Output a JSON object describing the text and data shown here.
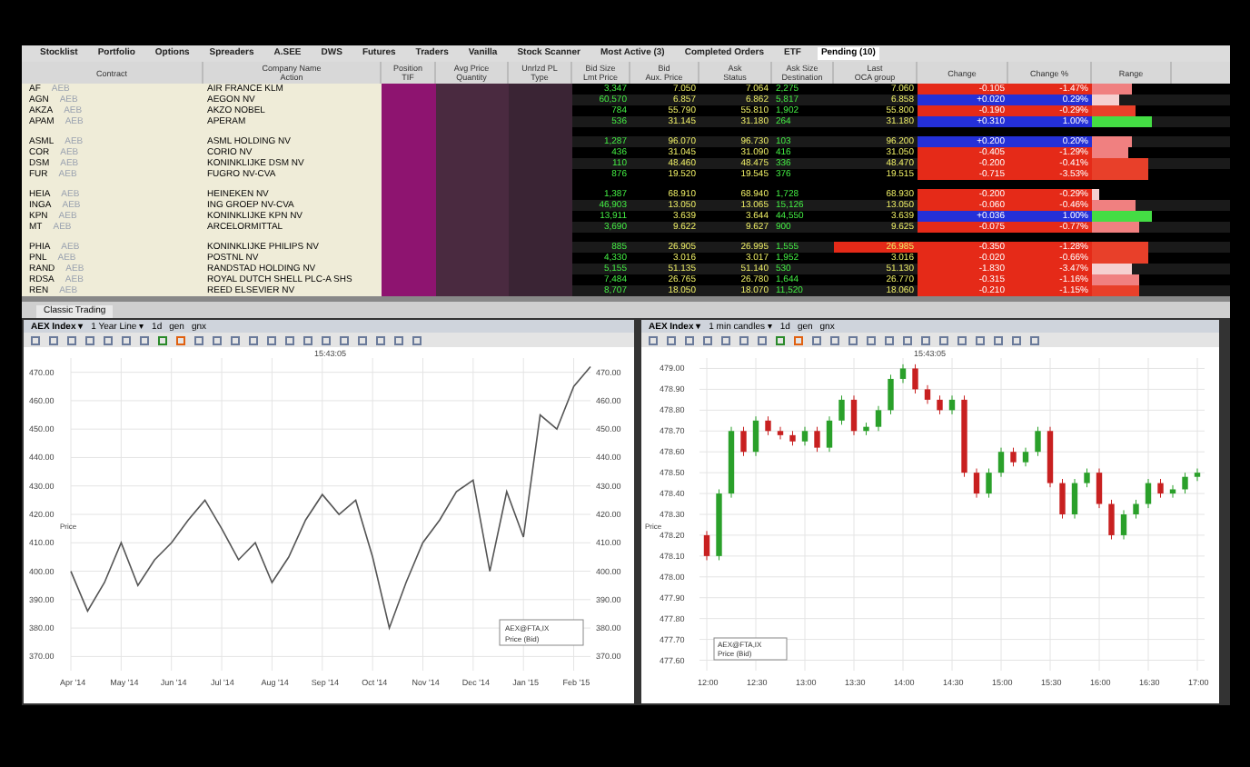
{
  "tabs": [
    {
      "label": "Stocklist",
      "selected": false
    },
    {
      "label": "Portfolio",
      "selected": false
    },
    {
      "label": "Options",
      "selected": false
    },
    {
      "label": "Spreaders",
      "selected": false
    },
    {
      "label": "A.SEE",
      "selected": false
    },
    {
      "label": "DWS",
      "selected": false
    },
    {
      "label": "Futures",
      "selected": false
    },
    {
      "label": "Traders",
      "selected": false
    },
    {
      "label": "Vanilla",
      "selected": false
    },
    {
      "label": "Stock Scanner",
      "selected": false
    },
    {
      "label": "Most Active (3)",
      "selected": false
    },
    {
      "label": "Completed Orders",
      "selected": false
    },
    {
      "label": "ETF",
      "selected": false
    },
    {
      "label": "Pending (10)",
      "selected": true
    }
  ],
  "columns": [
    {
      "top": "Contract"
    },
    {
      "top": "Company Name",
      "bottom": "Action"
    },
    {
      "top": "Position",
      "bottom": "TIF"
    },
    {
      "top": "Avg Price",
      "bottom": "Quantity"
    },
    {
      "top": "Unrlzd PL",
      "bottom": "Type"
    },
    {
      "top": "Bid Size",
      "bottom": "Lmt Price"
    },
    {
      "top": "Bid",
      "bottom": "Aux. Price"
    },
    {
      "top": "Ask",
      "bottom": "Status"
    },
    {
      "top": "Ask Size",
      "bottom": "Destination"
    },
    {
      "top": "Last",
      "bottom": "OCA group"
    },
    {
      "top": "Change"
    },
    {
      "top": "Change %"
    },
    {
      "top": "Range"
    }
  ],
  "rows": [
    {
      "kind": "stock",
      "symbol": "AF",
      "exchange": "AEB",
      "company": "AIR FRANCE KLM",
      "bid_size": "3,347",
      "bid": "7.050",
      "ask": "7.064",
      "ask_size": "2,275",
      "last": "7.060",
      "change": {
        "value": "-0.105",
        "color": "#e52a18"
      },
      "change_pct": "-1.47%",
      "last_highlight": false,
      "range": {
        "level": 0.5,
        "color": "#f08080"
      }
    },
    {
      "kind": "stock",
      "symbol": "AGN",
      "exchange": "AEB",
      "company": "AEGON NV",
      "bid_size": "60,570",
      "bid": "6.857",
      "ask": "6.862",
      "ask_size": "5,817",
      "last": "6.858",
      "change": {
        "value": "+0.020",
        "color": "#2430d8"
      },
      "change_pct": "0.29%",
      "last_highlight": false,
      "range": {
        "level": 0.35,
        "color": "#f5d0d0"
      }
    },
    {
      "kind": "stock",
      "symbol": "AKZA",
      "exchange": "AEB",
      "company": "AKZO NOBEL",
      "bid_size": "784",
      "bid": "55.790",
      "ask": "55.810",
      "ask_size": "1,902",
      "last": "55.800",
      "change": {
        "value": "-0.190",
        "color": "#e52a18"
      },
      "change_pct": "-0.29%",
      "last_highlight": false,
      "range": {
        "level": 0.55,
        "color": "#e8402a"
      }
    },
    {
      "kind": "stock",
      "symbol": "APAM",
      "exchange": "AEB",
      "company": "APERAM",
      "bid_size": "536",
      "bid": "31.145",
      "ask": "31.180",
      "ask_size": "264",
      "last": "31.180",
      "change": {
        "value": "+0.310",
        "color": "#2430d8"
      },
      "change_pct": "1.00%",
      "last_highlight": false,
      "range": {
        "level": 0.75,
        "color": "#44dd44"
      }
    },
    {
      "kind": "spacer"
    },
    {
      "kind": "stock",
      "symbol": "ASML",
      "exchange": "AEB",
      "company": "ASML HOLDING NV",
      "bid_size": "1,287",
      "bid": "96.070",
      "ask": "96.730",
      "ask_size": "103",
      "last": "96.200",
      "change": {
        "value": "+0.200",
        "color": "#2430d8"
      },
      "change_pct": "0.20%",
      "last_highlight": false,
      "range": {
        "level": 0.5,
        "color": "#f08080"
      }
    },
    {
      "kind": "stock",
      "symbol": "COR",
      "exchange": "AEB",
      "company": "CORIO NV",
      "bid_size": "436",
      "bid": "31.045",
      "ask": "31.090",
      "ask_size": "416",
      "last": "31.050",
      "change": {
        "value": "-0.405",
        "color": "#e52a18"
      },
      "change_pct": "-1.29%",
      "last_highlight": false,
      "range": {
        "level": 0.45,
        "color": "#f08080"
      }
    },
    {
      "kind": "stock",
      "symbol": "DSM",
      "exchange": "AEB",
      "company": "KONINKLIJKE DSM NV",
      "bid_size": "110",
      "bid": "48.460",
      "ask": "48.475",
      "ask_size": "336",
      "last": "48.470",
      "change": {
        "value": "-0.200",
        "color": "#e52a18"
      },
      "change_pct": "-0.41%",
      "last_highlight": false,
      "range": {
        "level": 0.7,
        "color": "#e8402a"
      }
    },
    {
      "kind": "stock",
      "symbol": "FUR",
      "exchange": "AEB",
      "company": "FUGRO NV-CVA",
      "bid_size": "876",
      "bid": "19.520",
      "ask": "19.545",
      "ask_size": "376",
      "last": "19.515",
      "change": {
        "value": "-0.715",
        "color": "#e52a18"
      },
      "change_pct": "-3.53%",
      "last_highlight": false,
      "range": {
        "level": 0.7,
        "color": "#e8402a"
      }
    },
    {
      "kind": "spacer"
    },
    {
      "kind": "stock",
      "symbol": "HEIA",
      "exchange": "AEB",
      "company": "HEINEKEN NV",
      "bid_size": "1,387",
      "bid": "68.910",
      "ask": "68.940",
      "ask_size": "1,728",
      "last": "68.930",
      "change": {
        "value": "-0.200",
        "color": "#e52a18"
      },
      "change_pct": "-0.29%",
      "last_highlight": false,
      "range": {
        "level": 0.1,
        "color": "#f5d0d0"
      }
    },
    {
      "kind": "stock",
      "symbol": "INGA",
      "exchange": "AEB",
      "company": "ING GROEP NV-CVA",
      "bid_size": "46,903",
      "bid": "13.050",
      "ask": "13.065",
      "ask_size": "15,126",
      "last": "13.050",
      "change": {
        "value": "-0.060",
        "color": "#e52a18"
      },
      "change_pct": "-0.46%",
      "last_highlight": false,
      "range": {
        "level": 0.55,
        "color": "#f08080"
      }
    },
    {
      "kind": "stock",
      "symbol": "KPN",
      "exchange": "AEB",
      "company": "KONINKLIJKE KPN NV",
      "bid_size": "13,911",
      "bid": "3.639",
      "ask": "3.644",
      "ask_size": "44,550",
      "last": "3.639",
      "change": {
        "value": "+0.036",
        "color": "#2430d8"
      },
      "change_pct": "1.00%",
      "last_highlight": false,
      "range": {
        "level": 0.75,
        "color": "#44dd44"
      }
    },
    {
      "kind": "stock",
      "symbol": "MT",
      "exchange": "AEB",
      "company": "ARCELORMITTAL",
      "bid_size": "3,690",
      "bid": "9.622",
      "ask": "9.627",
      "ask_size": "900",
      "last": "9.625",
      "change": {
        "value": "-0.075",
        "color": "#e52a18"
      },
      "change_pct": "-0.77%",
      "last_highlight": false,
      "range": {
        "level": 0.6,
        "color": "#f08080"
      }
    },
    {
      "kind": "spacer"
    },
    {
      "kind": "stock",
      "symbol": "PHIA",
      "exchange": "AEB",
      "company": "KONINKLIJKE PHILIPS NV",
      "bid_size": "885",
      "bid": "26.905",
      "ask": "26.995",
      "ask_size": "1,555",
      "last": "26.985",
      "change": {
        "value": "-0.350",
        "color": "#e52a18"
      },
      "change_pct": "-1.28%",
      "last_highlight": true,
      "range": {
        "level": 0.7,
        "color": "#e8402a"
      }
    },
    {
      "kind": "stock",
      "symbol": "PNL",
      "exchange": "AEB",
      "company": "POSTNL NV",
      "bid_size": "4,330",
      "bid": "3.016",
      "ask": "3.017",
      "ask_size": "1,952",
      "last": "3.016",
      "change": {
        "value": "-0.020",
        "color": "#e52a18"
      },
      "change_pct": "-0.66%",
      "last_highlight": false,
      "range": {
        "level": 0.7,
        "color": "#e8402a"
      }
    },
    {
      "kind": "stock",
      "symbol": "RAND",
      "exchange": "AEB",
      "company": "RANDSTAD HOLDING NV",
      "bid_size": "5,155",
      "bid": "51.135",
      "ask": "51.140",
      "ask_size": "530",
      "last": "51.130",
      "change": {
        "value": "-1.830",
        "color": "#e52a18"
      },
      "change_pct": "-3.47%",
      "last_highlight": false,
      "range": {
        "level": 0.5,
        "color": "#f5d0d0"
      }
    },
    {
      "kind": "stock",
      "symbol": "RDSA",
      "exchange": "AEB",
      "company": "ROYAL DUTCH SHELL PLC-A SHS",
      "bid_size": "7,484",
      "bid": "26.765",
      "ask": "26.780",
      "ask_size": "1,644",
      "last": "26.770",
      "change": {
        "value": "-0.315",
        "color": "#e52a18"
      },
      "change_pct": "-1.16%",
      "last_highlight": false,
      "range": {
        "level": 0.6,
        "color": "#f08080"
      }
    },
    {
      "kind": "stock",
      "symbol": "REN",
      "exchange": "AEB",
      "company": "REED ELSEVIER NV",
      "bid_size": "8,707",
      "bid": "18.050",
      "ask": "18.070",
      "ask_size": "11,520",
      "last": "18.060",
      "change": {
        "value": "-0.210",
        "color": "#e52a18"
      },
      "change_pct": "-1.15%",
      "last_highlight": false,
      "range": {
        "level": 0.6,
        "color": "#e8402a"
      }
    }
  ],
  "bottom_tab": "Classic Trading",
  "charts": [
    {
      "instrument": "AEX Index ▾",
      "period": "1 Year Line ▾",
      "options": [
        "1d",
        "gen",
        "gnx"
      ],
      "time": "15:43:05",
      "legend": [
        "Price (Bid)"
      ],
      "right_axis_labels": [
        "470.00",
        "460.00",
        "450.00",
        "440.00",
        "430.00",
        "420.00",
        "410.00",
        "400.00",
        "390.00",
        "380.00",
        "370.00"
      ],
      "chart_data": {
        "type": "line",
        "ylabel": "Price",
        "grid": true,
        "categories": [
          "Apr '14",
          null,
          null,
          "May '14",
          null,
          null,
          "Jun '14",
          null,
          null,
          "Jul '14",
          null,
          null,
          "Aug '14",
          null,
          null,
          "Sep '14",
          null,
          null,
          "Oct '14",
          null,
          null,
          "Nov '14",
          null,
          null,
          "Dec '14",
          null,
          null,
          "Jan '15",
          null,
          null,
          "Feb '15",
          null
        ],
        "series": [
          {
            "name": "AEX@FTA,IX",
            "color": "#555555",
            "values": [
              400,
              386,
              396,
              410,
              395,
              404,
              410,
              418,
              425,
              415,
              404,
              410,
              396,
              405,
              418,
              427,
              420,
              425,
              405,
              380,
              396,
              410,
              418,
              428,
              432,
              400,
              428,
              412,
              455,
              450,
              465,
              472
            ]
          }
        ],
        "ylim": [
          365,
          475
        ],
        "yticks": [
          {
            "value": 470,
            "label": "470.00"
          },
          {
            "value": 460,
            "label": "460.00"
          },
          {
            "value": 450,
            "label": "450.00"
          },
          {
            "value": 440,
            "label": "440.00"
          },
          {
            "value": 430,
            "label": "430.00"
          },
          {
            "value": 420,
            "label": "420.00"
          },
          {
            "value": 410,
            "label": "410.00"
          },
          {
            "value": 400,
            "label": "400.00"
          },
          {
            "value": 390,
            "label": "390.00"
          },
          {
            "value": 380,
            "label": "380.00"
          },
          {
            "value": 370,
            "label": "370.00"
          }
        ]
      }
    },
    {
      "instrument": "AEX Index ▾",
      "period": "1 min candles ▾",
      "options": [
        "1d",
        "gen",
        "gnx"
      ],
      "time": "15:43:05",
      "legend": [
        "AEX@FTA,IX",
        "Price (Bid)"
      ],
      "chart_data": {
        "type": "candlestick",
        "ylabel": "Price",
        "grid": true,
        "categories": [
          "12:00",
          null,
          null,
          null,
          "12:30",
          null,
          null,
          null,
          "13:00",
          null,
          null,
          null,
          "13:30",
          null,
          null,
          null,
          "14:00",
          null,
          null,
          null,
          "14:30",
          null,
          null,
          null,
          "15:00",
          null,
          null,
          null,
          "15:30",
          null,
          null,
          null,
          "16:00",
          null,
          null,
          null,
          "16:30",
          null,
          null,
          null,
          "17:00"
        ],
        "ohlc": [
          [
            478.2,
            478.22,
            478.08,
            478.1
          ],
          [
            478.1,
            478.42,
            478.08,
            478.4
          ],
          [
            478.4,
            478.72,
            478.38,
            478.7
          ],
          [
            478.7,
            478.72,
            478.58,
            478.6
          ],
          [
            478.6,
            478.77,
            478.58,
            478.75
          ],
          [
            478.75,
            478.77,
            478.68,
            478.7
          ],
          [
            478.7,
            478.72,
            478.66,
            478.68
          ],
          [
            478.68,
            478.7,
            478.63,
            478.65
          ],
          [
            478.65,
            478.72,
            478.63,
            478.7
          ],
          [
            478.7,
            478.72,
            478.6,
            478.62
          ],
          [
            478.62,
            478.77,
            478.6,
            478.75
          ],
          [
            478.75,
            478.87,
            478.73,
            478.85
          ],
          [
            478.85,
            478.87,
            478.68,
            478.7
          ],
          [
            478.7,
            478.74,
            478.68,
            478.72
          ],
          [
            478.72,
            478.82,
            478.7,
            478.8
          ],
          [
            478.8,
            478.97,
            478.78,
            478.95
          ],
          [
            478.95,
            479.02,
            478.93,
            479.0
          ],
          [
            479.0,
            479.02,
            478.88,
            478.9
          ],
          [
            478.9,
            478.92,
            478.83,
            478.85
          ],
          [
            478.85,
            478.87,
            478.78,
            478.8
          ],
          [
            478.8,
            478.87,
            478.78,
            478.85
          ],
          [
            478.85,
            478.87,
            478.48,
            478.5
          ],
          [
            478.5,
            478.52,
            478.38,
            478.4
          ],
          [
            478.4,
            478.52,
            478.38,
            478.5
          ],
          [
            478.5,
            478.62,
            478.48,
            478.6
          ],
          [
            478.6,
            478.62,
            478.53,
            478.55
          ],
          [
            478.55,
            478.62,
            478.53,
            478.6
          ],
          [
            478.6,
            478.72,
            478.58,
            478.7
          ],
          [
            478.7,
            478.72,
            478.43,
            478.45
          ],
          [
            478.45,
            478.47,
            478.28,
            478.3
          ],
          [
            478.3,
            478.47,
            478.28,
            478.45
          ],
          [
            478.45,
            478.52,
            478.43,
            478.5
          ],
          [
            478.5,
            478.52,
            478.33,
            478.35
          ],
          [
            478.35,
            478.37,
            478.18,
            478.2
          ],
          [
            478.2,
            478.32,
            478.18,
            478.3
          ],
          [
            478.3,
            478.37,
            478.28,
            478.35
          ],
          [
            478.35,
            478.47,
            478.33,
            478.45
          ],
          [
            478.45,
            478.47,
            478.38,
            478.4
          ],
          [
            478.4,
            478.44,
            478.38,
            478.42
          ],
          [
            478.42,
            478.5,
            478.4,
            478.48
          ],
          [
            478.48,
            478.52,
            478.46,
            478.5
          ]
        ],
        "ylim": [
          477.55,
          479.05
        ],
        "yticks": [
          {
            "value": 479.0,
            "label": "479.00"
          },
          {
            "value": 478.9,
            "label": "478.90"
          },
          {
            "value": 478.8,
            "label": "478.80"
          },
          {
            "value": 478.7,
            "label": "478.70"
          },
          {
            "value": 478.6,
            "label": "478.60"
          },
          {
            "value": 478.5,
            "label": "478.50"
          },
          {
            "value": 478.4,
            "label": "478.40"
          },
          {
            "value": 478.3,
            "label": "478.30"
          },
          {
            "value": 478.2,
            "label": "478.20"
          },
          {
            "value": 478.1,
            "label": "478.10"
          },
          {
            "value": 478.0,
            "label": "478.00"
          },
          {
            "value": 477.9,
            "label": "477.90"
          },
          {
            "value": 477.8,
            "label": "477.80"
          },
          {
            "value": 477.7,
            "label": "477.70"
          },
          {
            "value": 477.6,
            "label": "477.60"
          }
        ]
      }
    }
  ]
}
